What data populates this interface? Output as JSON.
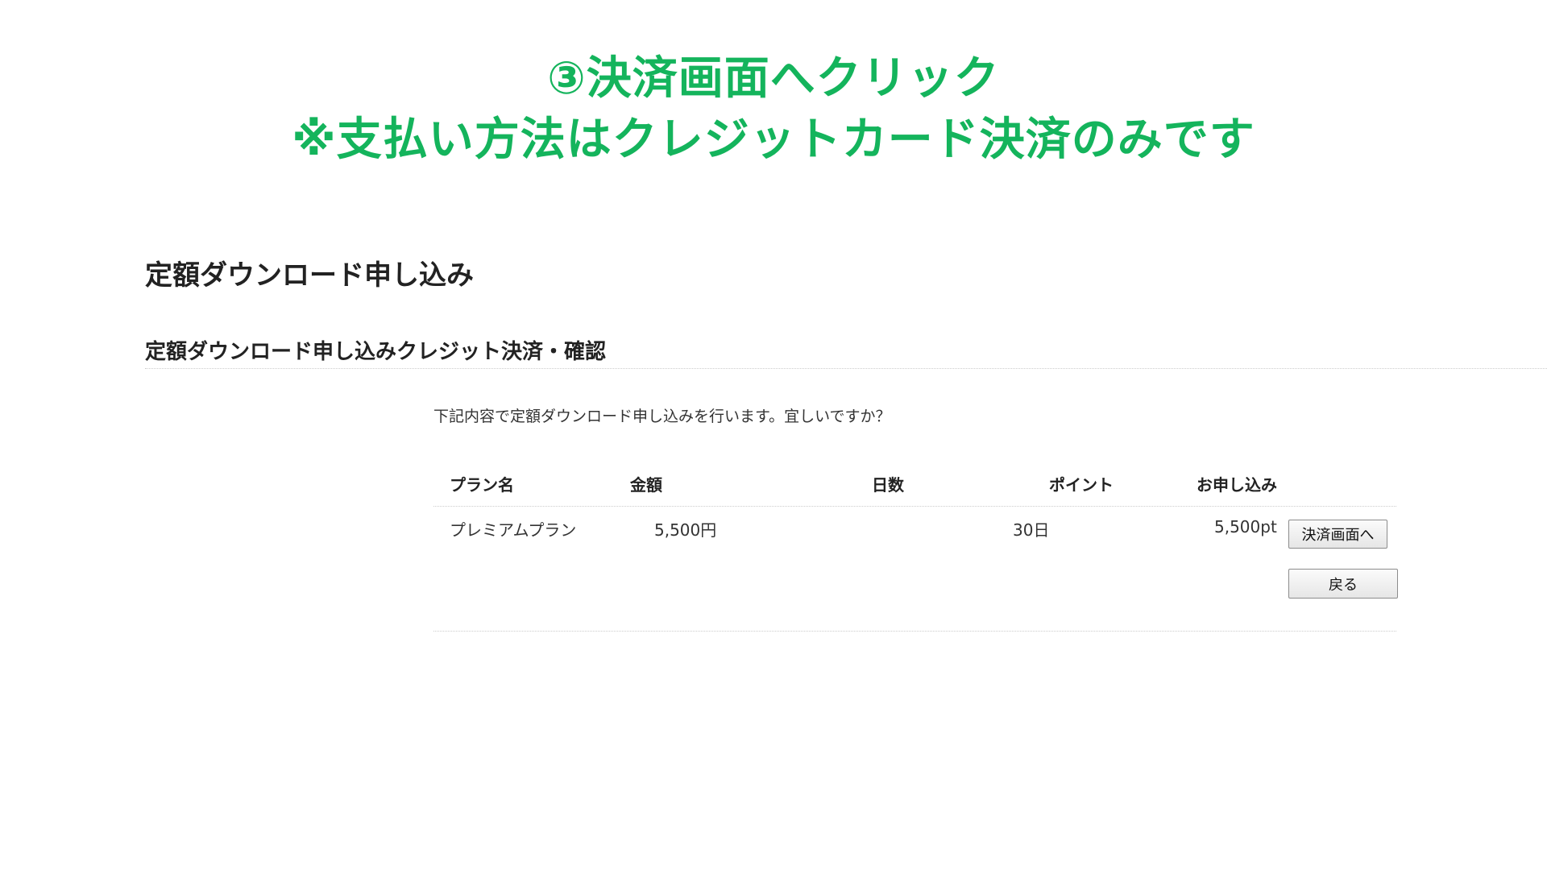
{
  "banner": {
    "line1": "③決済画面へクリック",
    "line2": "※支払い方法はクレジットカード決済のみです"
  },
  "page_title": "定額ダウンロード申し込み",
  "section_title": "定額ダウンロード申し込みクレジット決済・確認",
  "confirm_message": "下記内容で定額ダウンロード申し込みを行います。宜しいですか？",
  "table": {
    "headers": [
      "プラン名",
      "金額",
      "日数",
      "ポイント",
      "お申し込み"
    ],
    "row": {
      "plan": "プレミアムプラン",
      "price": "5,500円",
      "days": "30日",
      "points": "5,500pt"
    }
  },
  "buttons": {
    "pay": "決済画面へ",
    "back": "戻る"
  },
  "colors": {
    "banner_accent": "#14b45c"
  }
}
